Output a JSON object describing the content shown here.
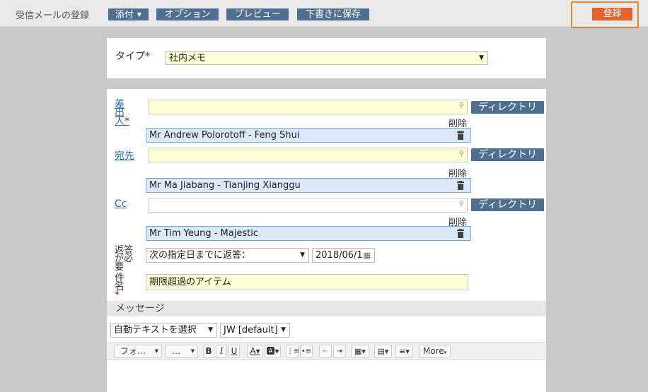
{
  "topbar": {
    "title": "受信メールの登録",
    "attach_label": "添付",
    "options_label": "オプション",
    "preview_label": "プレビュー",
    "save_draft_label": "下書きに保存",
    "register_label": "登録"
  },
  "type_panel": {
    "label": "タイプ",
    "required_mark": "*",
    "value": "社内メモ"
  },
  "form": {
    "sender_label": "差出人",
    "sender_required": "*",
    "sender_input": "",
    "recipient_label": "宛先",
    "cc_label": "Cc",
    "directory_label": "ディレクトリ",
    "delete_label": "削除",
    "sender_tag": "Mr Andrew Polorotoff - Feng Shui",
    "recipient_tag": "Mr Ma Jiabang - Tianjing Xianggu",
    "cc_tag": "Mr Tim Yeung - Majestic",
    "reply_label": "返答が必要",
    "reply_option": "次の指定日までに返答：",
    "reply_date": "2018/06/1",
    "subject_label": "件名",
    "subject_required": "*",
    "subject_value": "期限超過のアイテム"
  },
  "message": {
    "section_label": "メッセージ",
    "auto_text": "自動テキストを選択",
    "signature": "JW [default]",
    "font_select": "フォ…",
    "size_select": "…",
    "more_label": "More"
  }
}
